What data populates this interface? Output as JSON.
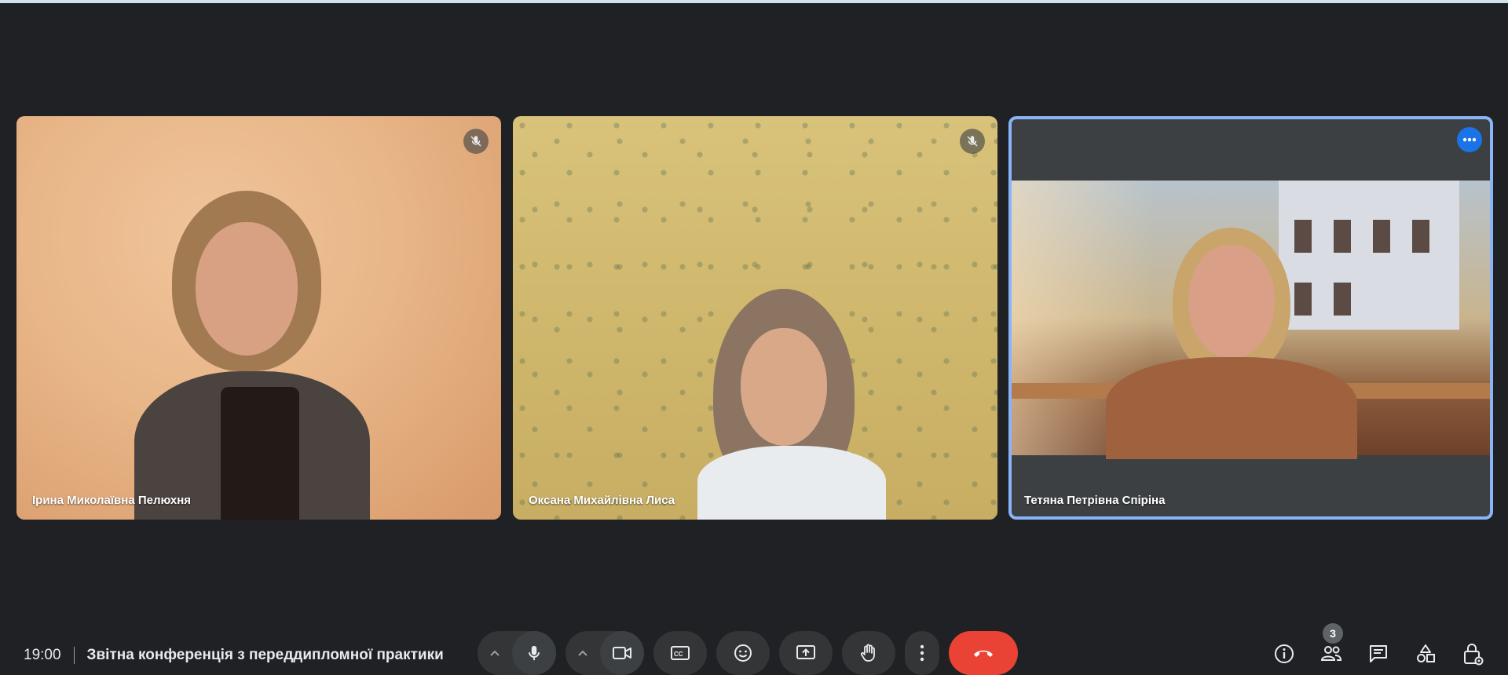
{
  "participants": [
    {
      "name": "Ірина Миколаївна Пелюхня",
      "muted": true
    },
    {
      "name": "Оксана Михайлівна Лиса",
      "muted": true
    },
    {
      "name": "Тетяна Петрівна Спіріна",
      "muted": false,
      "active_speaker": true
    }
  ],
  "meeting": {
    "time": "19:00",
    "title": "Звітна конференція з переддипломної практики"
  },
  "people": {
    "count": "3"
  },
  "colors": {
    "background": "#202124",
    "active_border": "#8ab4f8",
    "end_call": "#ea4335",
    "more_badge": "#1a73e8"
  },
  "icons": {
    "controls": [
      "chevron-up-icon",
      "microphone-icon",
      "chevron-up-icon",
      "camera-icon",
      "captions-icon",
      "emoji-icon",
      "present-screen-icon",
      "raise-hand-icon",
      "more-vert-icon",
      "end-call-icon"
    ],
    "side": [
      "info-icon",
      "people-icon",
      "chat-icon",
      "activities-icon",
      "host-controls-icon"
    ]
  }
}
